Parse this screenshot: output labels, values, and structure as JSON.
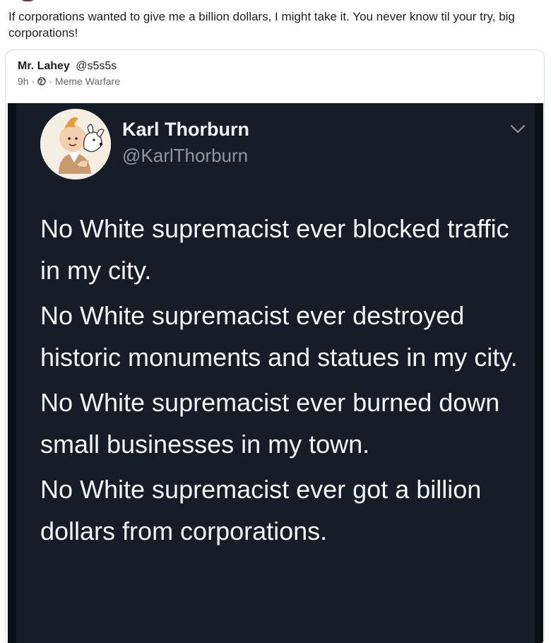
{
  "post": {
    "text": "If corporations wanted to give me a billion dollars, I might take it. You never know til your try, big corporations!"
  },
  "quoted": {
    "author_name": "Mr. Lahey",
    "author_handle": "@s5s5s",
    "time": "9h",
    "separator": "·",
    "group": "Meme Warfare",
    "icons": [
      "globe-icon"
    ]
  },
  "meme": {
    "name": "Karl Thorburn",
    "handle": "@KarlThorburn",
    "paragraphs": [
      "No White supremacist ever blocked traffic in my city.",
      "No White supremacist ever destroyed historic monuments and statues in my city.",
      "No White supremacist ever burned down small businesses in my town.",
      "No White supremacist ever got a billion dollars from corporations."
    ],
    "icons": [
      "chevron-down-icon",
      "avatar"
    ],
    "colors": {
      "background": "#161d29",
      "text": "#f3f5f8",
      "handle": "#8c97a6"
    }
  }
}
